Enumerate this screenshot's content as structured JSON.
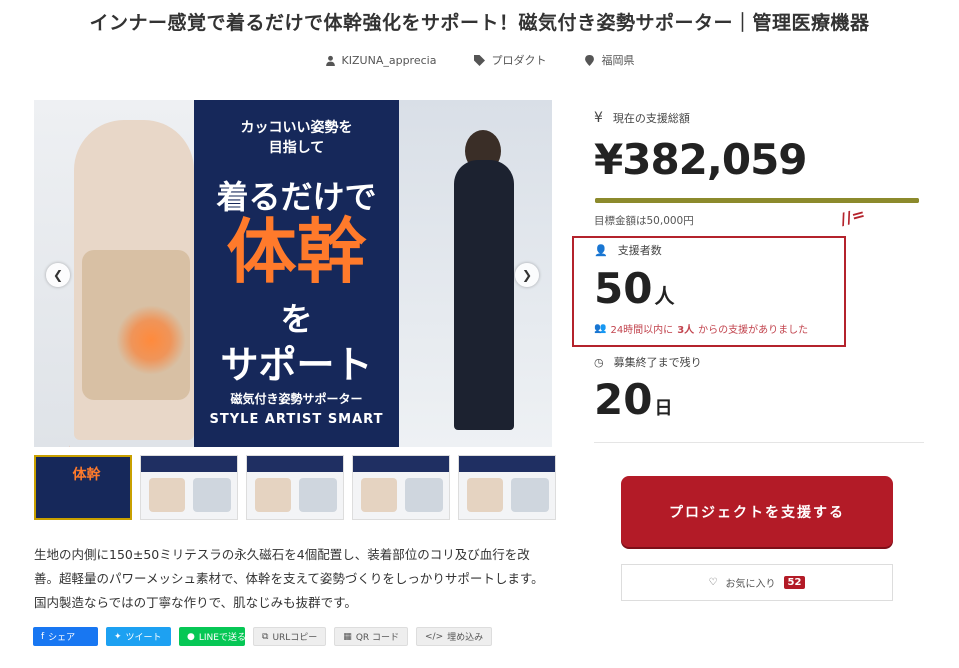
{
  "title": "インナー感覚で着るだけで体幹強化をサポート！磁気付き姿勢サポーター｜管理医療機器",
  "meta": {
    "owner": "KIZUNA_apprecia",
    "category": "プロダクト",
    "location": "福岡県"
  },
  "main_image": {
    "line1a": "カッコいい姿勢を",
    "line1b": "目指して",
    "line2": "着るだけで",
    "line3": "体幹",
    "line4": "を",
    "line5": "サポート",
    "line6": "磁気付き姿勢サポーター",
    "line7": "STYLE ARTIST SMART"
  },
  "thumbs": [
    {
      "text": "体幹"
    }
  ],
  "description": {
    "p1": "生地の内側に150±50ミリテスラの永久磁石を4個配置し、装着部位のコリ及び血行を改善。超軽量のパワーメッシュ素材で、体幹を支えて姿勢づくりをしっかりサポートします。国内製造ならではの丁寧な作りで、肌なじみも抜群です。"
  },
  "share": {
    "facebook": "シェア",
    "twitter": "ツイート",
    "line": "LINEで送る",
    "url_copy": "URLコピー",
    "qr": "QR コード",
    "embed": "埋め込み"
  },
  "funding": {
    "total_label": "現在の支援総額",
    "total_amount": "¥382,059",
    "goal_text": "目標金額は50,000円",
    "progress_fraction": 1.0,
    "backers_label": "支援者数",
    "backers_count": "50",
    "backers_unit": "人",
    "recent_prefix": "24時間以内に",
    "recent_count": "3人",
    "recent_suffix": "からの支援がありました",
    "days_label": "募集終了まで残り",
    "days_count": "20",
    "days_unit": "日",
    "support_button": "プロジェクトを支援する",
    "favorite_label": "お気に入り",
    "favorite_count": "52"
  },
  "colors": {
    "accent_red": "#b31b27",
    "progress": "#8c8a2c",
    "highlight_box": "#b4232c"
  }
}
